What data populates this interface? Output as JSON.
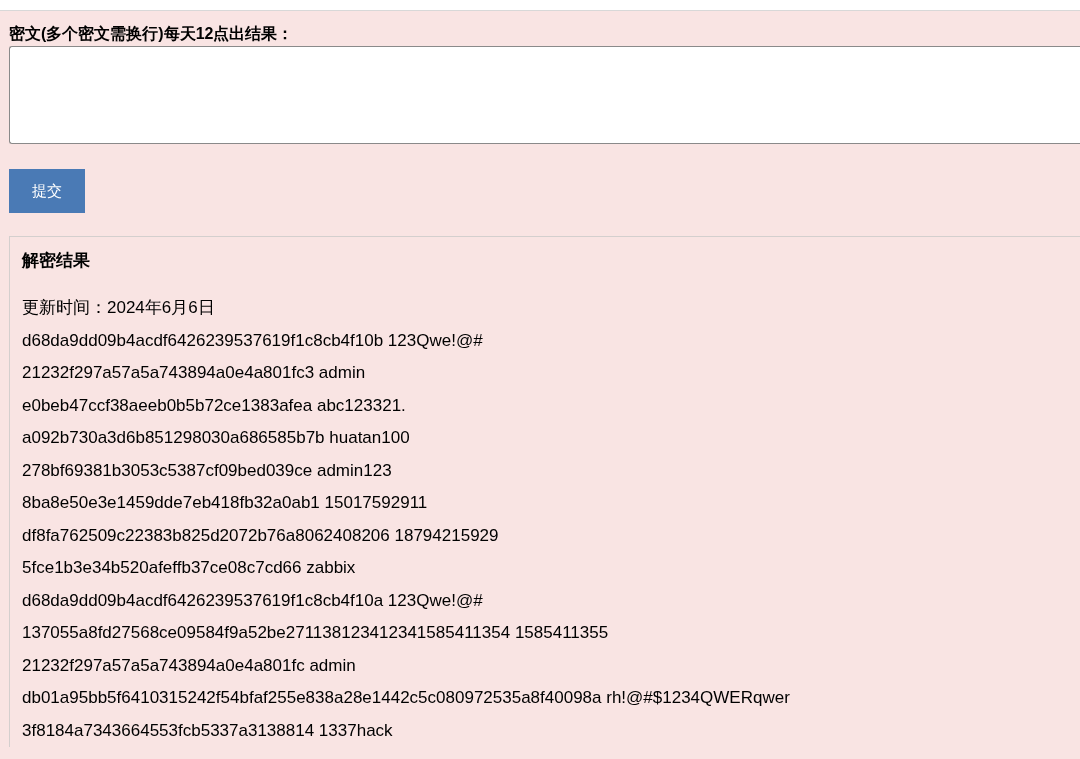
{
  "form": {
    "label": "密文(多个密文需换行)每天12点出结果：",
    "submit_button": "提交"
  },
  "results": {
    "title": "解密结果",
    "updated": "更新时间：2024年6月6日",
    "lines": [
      "d68da9dd09b4acdf6426239537619f1c8cb4f10b 123Qwe!@#",
      "21232f297a57a5a743894a0e4a801fc3 admin",
      "e0beb47ccf38aeeb0b5b72ce1383afea abc123321.",
      "a092b730a3d6b851298030a686585b7b huatan100",
      "278bf69381b3053c5387cf09bed039ce admin123",
      "8ba8e50e3e1459dde7eb418fb32a0ab1 15017592911",
      "df8fa762509c22383b825d2072b76a8062408206 18794215929",
      "5fce1b3e34b520afeffb37ce08c7cd66 zabbix",
      "d68da9dd09b4acdf6426239537619f1c8cb4f10a 123Qwe!@#",
      "137055a8fd27568ce09584f9a52be271138123412341585411354 1585411355",
      "21232f297a57a5a743894a0e4a801fc admin",
      "db01a95bb5f6410315242f54bfaf255e838a28e1442c5c080972535a8f40098a rh!@#$1234QWERqwer",
      "3f8184a7343664553fcb5337a3138814 1337hack"
    ]
  }
}
